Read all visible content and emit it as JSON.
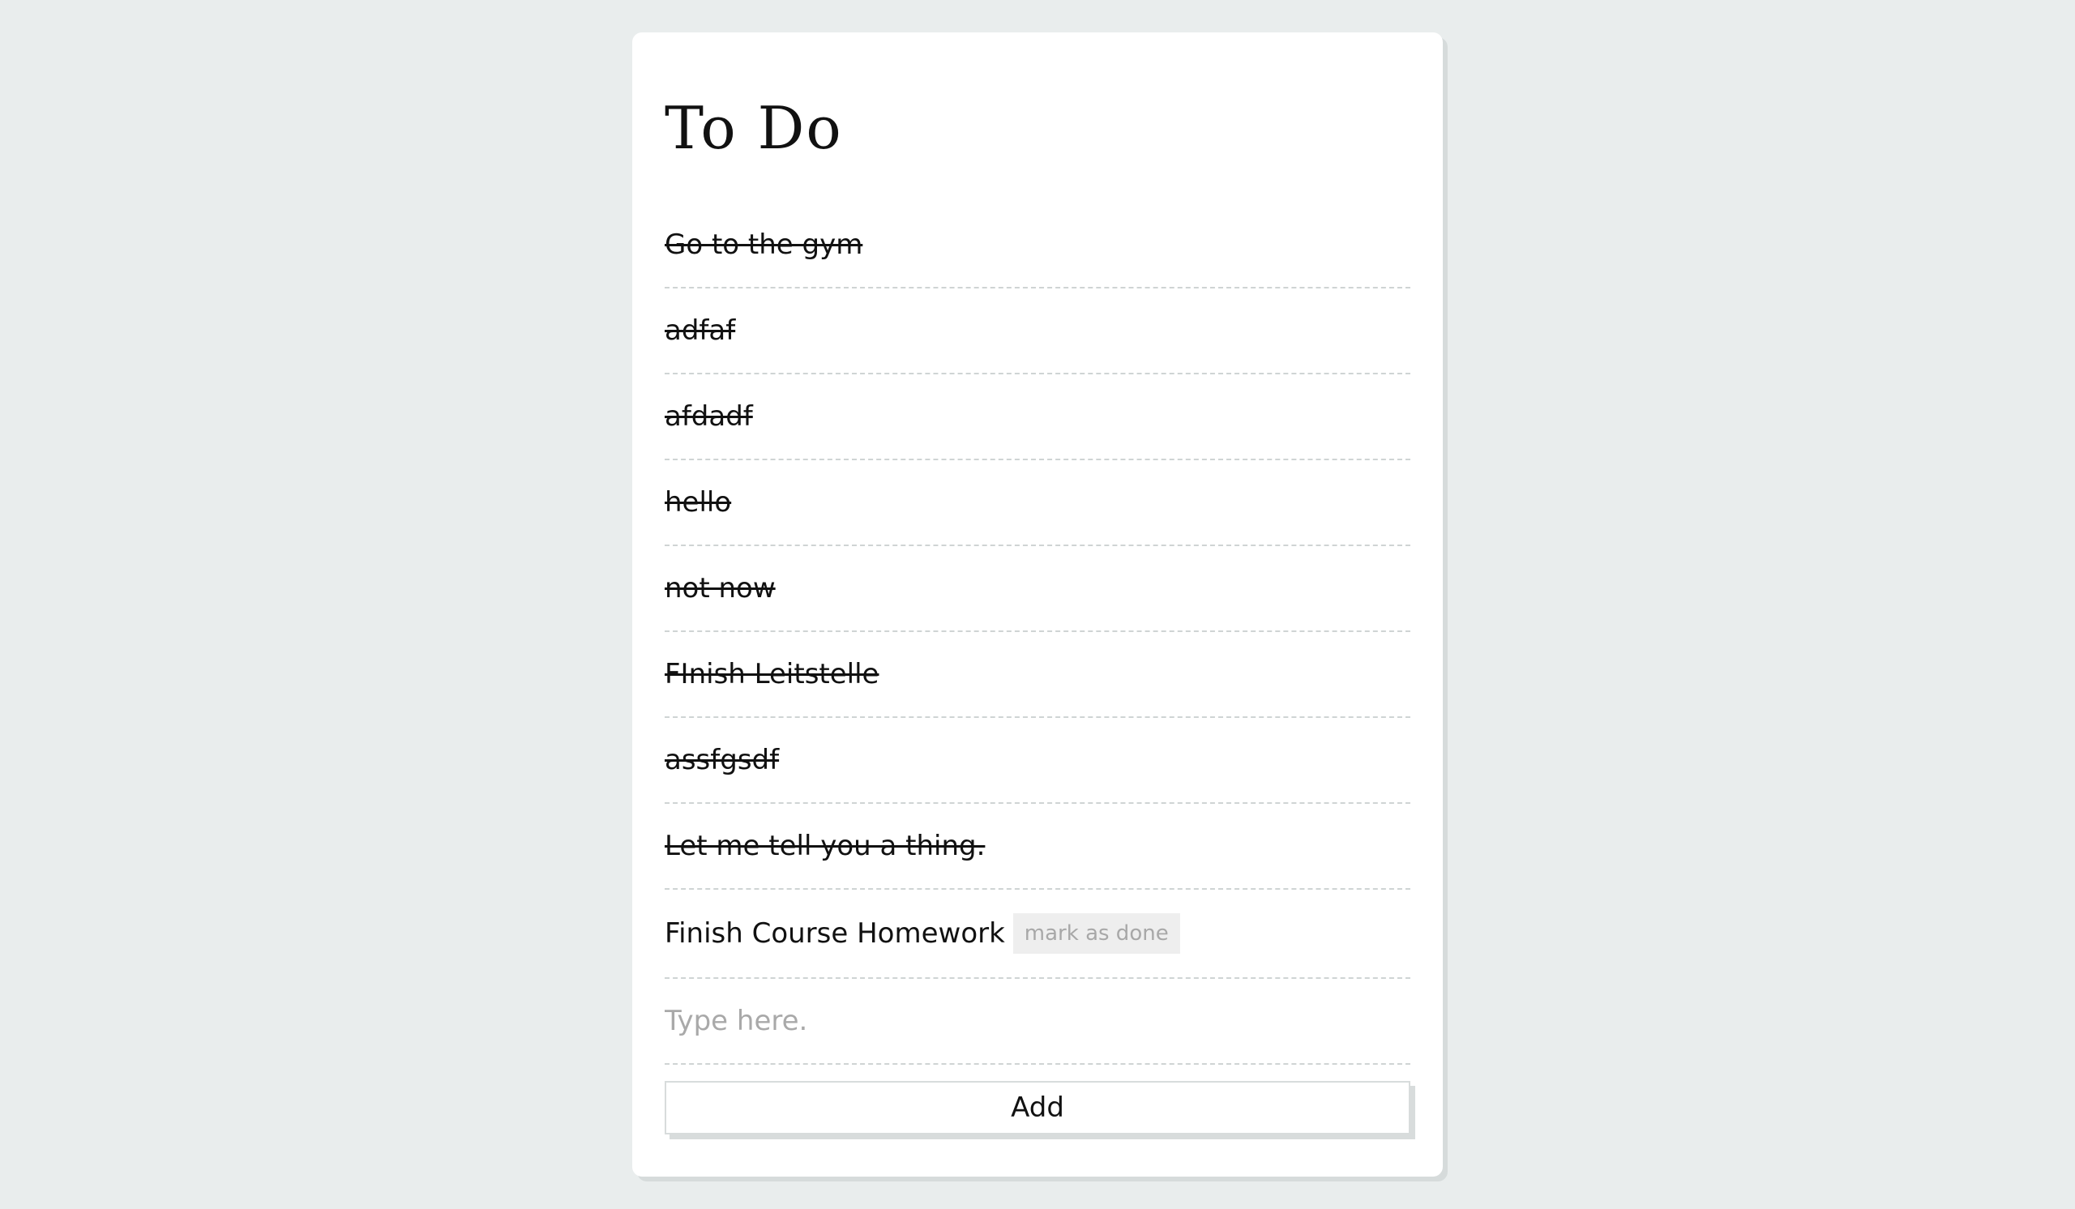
{
  "title": "To Do",
  "items": [
    {
      "text": "Go to the gym",
      "done": true
    },
    {
      "text": "adfaf",
      "done": true
    },
    {
      "text": "afdadf",
      "done": true
    },
    {
      "text": "hello",
      "done": true
    },
    {
      "text": "not now",
      "done": true
    },
    {
      "text": "FInish Leitstelle",
      "done": true
    },
    {
      "text": "assfgsdf",
      "done": true
    },
    {
      "text": "Let me tell you a thing.",
      "done": true
    },
    {
      "text": "Finish Course Homework",
      "done": false,
      "action_label": "mark as done"
    }
  ],
  "new_item": {
    "value": "",
    "placeholder": "Type here."
  },
  "add_button_label": "Add",
  "colors": {
    "background": "#e9eded",
    "card": "#ffffff",
    "divider": "#cfd4d4",
    "placeholder": "#a9a9a9",
    "mark_button_bg": "#eeeeee",
    "mark_button_text": "#a8a8a8"
  }
}
